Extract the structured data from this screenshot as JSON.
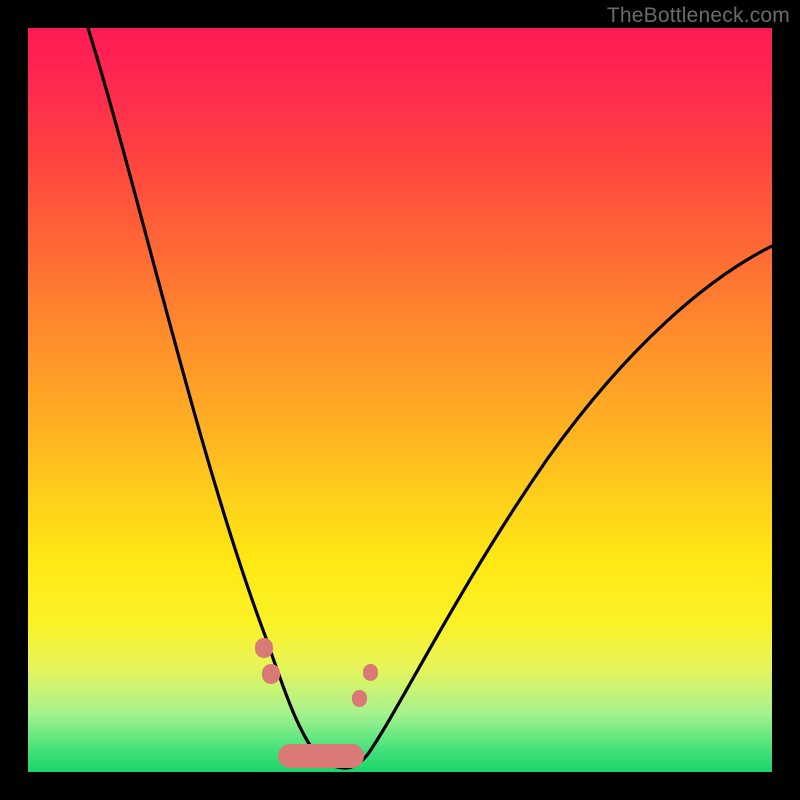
{
  "watermark": "TheBottleneck.com",
  "colors": {
    "frame": "#000000",
    "curve": "#000000",
    "blob": "#d97a77",
    "gradient_stops": [
      "#ff1b55",
      "#ff2a4f",
      "#ff4540",
      "#ff6a34",
      "#ff8f2b",
      "#ffb222",
      "#ffd21a",
      "#ffe914",
      "#fbf227",
      "#e6f55a",
      "#a8f28e",
      "#44e27a",
      "#19d46a"
    ]
  },
  "chart_data": {
    "type": "line",
    "title": "",
    "xlabel": "",
    "ylabel": "",
    "xlim": [
      0,
      100
    ],
    "ylim": [
      0,
      100
    ],
    "background": "rainbow-vertical-gradient",
    "note": "y-axis is inverted visually (0 at bottom = green, 100 at top = red); curve is a V-shaped dip",
    "series": [
      {
        "name": "bottleneck-curve",
        "x": [
          8,
          12,
          16,
          20,
          24,
          28,
          31,
          34,
          36,
          38,
          40,
          42,
          44,
          48,
          54,
          60,
          68,
          76,
          84,
          92,
          99
        ],
        "y": [
          100,
          84,
          68,
          54,
          41,
          29,
          19,
          11,
          6,
          3,
          1,
          2,
          4,
          8,
          16,
          25,
          36,
          46,
          55,
          63,
          70
        ]
      }
    ],
    "annotations": [
      {
        "name": "blob-left-upper",
        "x": 31.5,
        "y": 17,
        "size": 2.1
      },
      {
        "name": "blob-left-lower",
        "x": 32.3,
        "y": 13,
        "size": 2.1
      },
      {
        "name": "blob-right-upper",
        "x": 46.0,
        "y": 13,
        "size": 1.8
      },
      {
        "name": "blob-right-lower",
        "x": 44.5,
        "y": 9,
        "size": 1.8
      },
      {
        "name": "blob-bottom-bar",
        "x": 38.5,
        "y": 2,
        "w": 11,
        "h": 3.2,
        "shape": "capsule"
      }
    ]
  }
}
